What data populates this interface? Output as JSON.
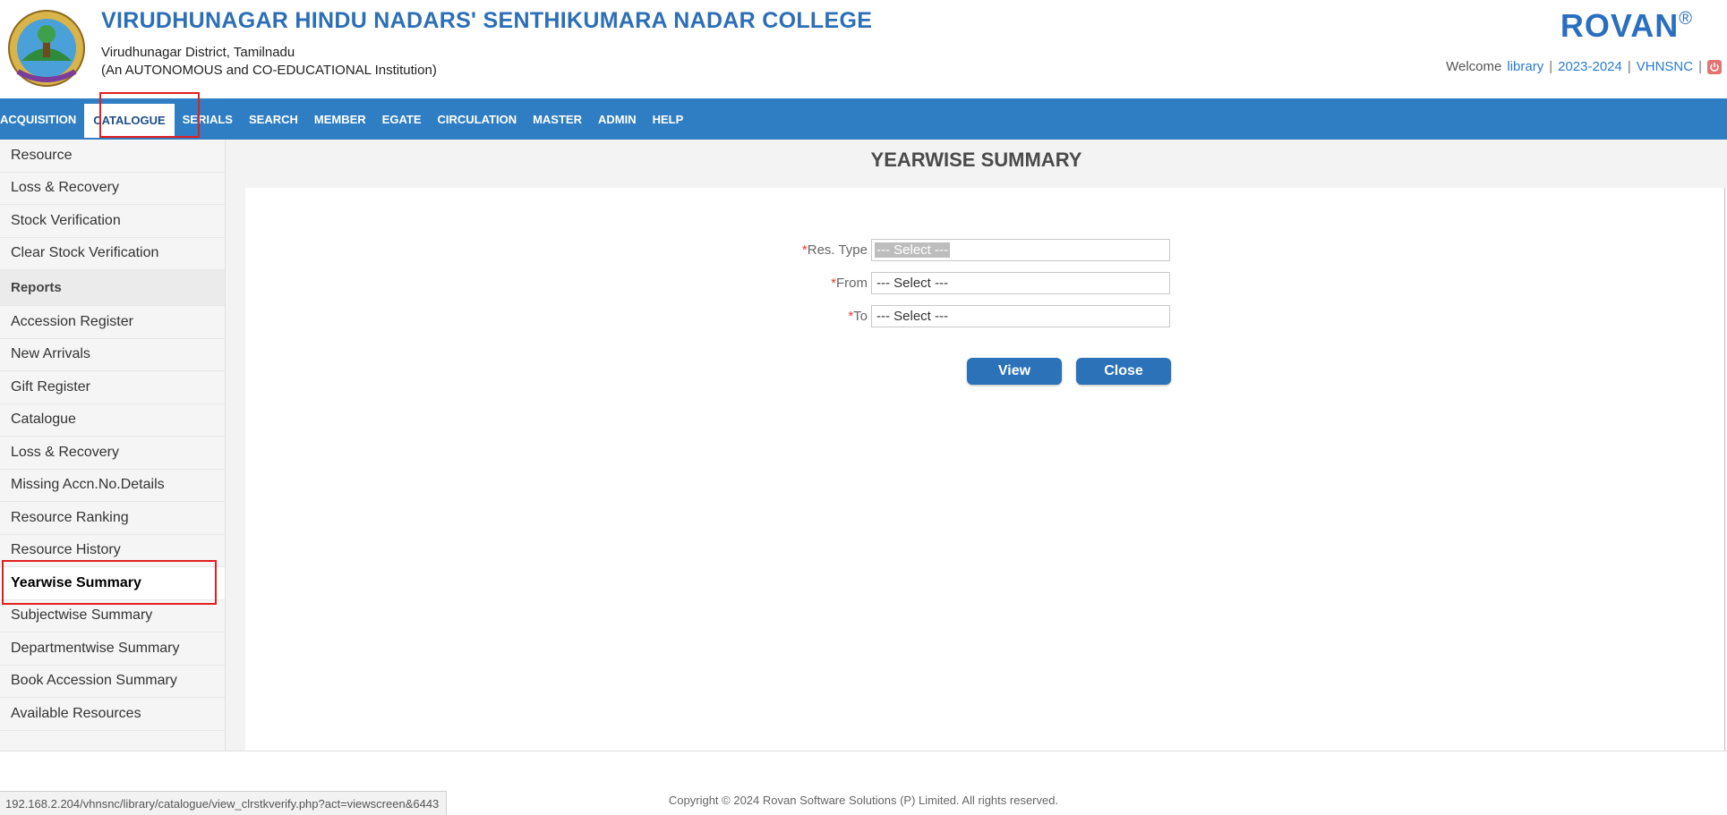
{
  "header": {
    "college_name": "VIRUDHUNAGAR HINDU NADARS' SENTHIKUMARA NADAR COLLEGE",
    "location": "Virudhunagar District, Tamilnadu",
    "institution_type": "(An AUTONOMOUS and CO-EDUCATIONAL Institution)",
    "brand": "ROVAN",
    "brand_mark": "®",
    "welcome_text": "Welcome",
    "user": "library",
    "academic_year": "2023-2024",
    "institution_code": "VHNSNC",
    "logout_icon": "power-icon"
  },
  "menu": {
    "items": [
      "ACQUISITION",
      "CATALOGUE",
      "SERIALS",
      "SEARCH",
      "MEMBER",
      "EGATE",
      "CIRCULATION",
      "MASTER",
      "ADMIN",
      "HELP"
    ],
    "active": "CATALOGUE"
  },
  "sidebar": {
    "items": [
      "Resource",
      "Loss & Recovery",
      "Stock Verification",
      "Clear Stock Verification",
      "Reports",
      "Accession Register",
      "New Arrivals",
      "Gift Register",
      "Catalogue",
      "Loss & Recovery",
      "Missing Accn.No.Details",
      "Resource Ranking",
      "Resource History",
      "Yearwise Summary",
      "Subjectwise Summary",
      "Departmentwise Summary",
      "Book Accession Summary",
      "Available Resources"
    ],
    "selected": "Yearwise Summary",
    "collapse_icon": "chevron-left-icon"
  },
  "main": {
    "title": "YEARWISE SUMMARY",
    "form": {
      "res_type_label": "Res. Type",
      "res_type_value": "--- Select ---",
      "from_label": "From",
      "from_value": "--- Select ---",
      "to_label": "To",
      "to_value": "--- Select ---",
      "required_mark": "*"
    },
    "buttons": {
      "view": "View",
      "close": "Close"
    }
  },
  "footer": {
    "copyright": "Copyright © 2024 Rovan Software Solutions (P) Limited. All rights reserved.",
    "status_url": "192.168.2.204/vhnsnc/library/catalogue/view_clrstkverify.php?act=viewscreen&6443"
  },
  "colors": {
    "menubar": "#2f7ec3",
    "button": "#2c72b8",
    "highlight_box": "#e21f1f",
    "title": "#2c6fb7"
  }
}
